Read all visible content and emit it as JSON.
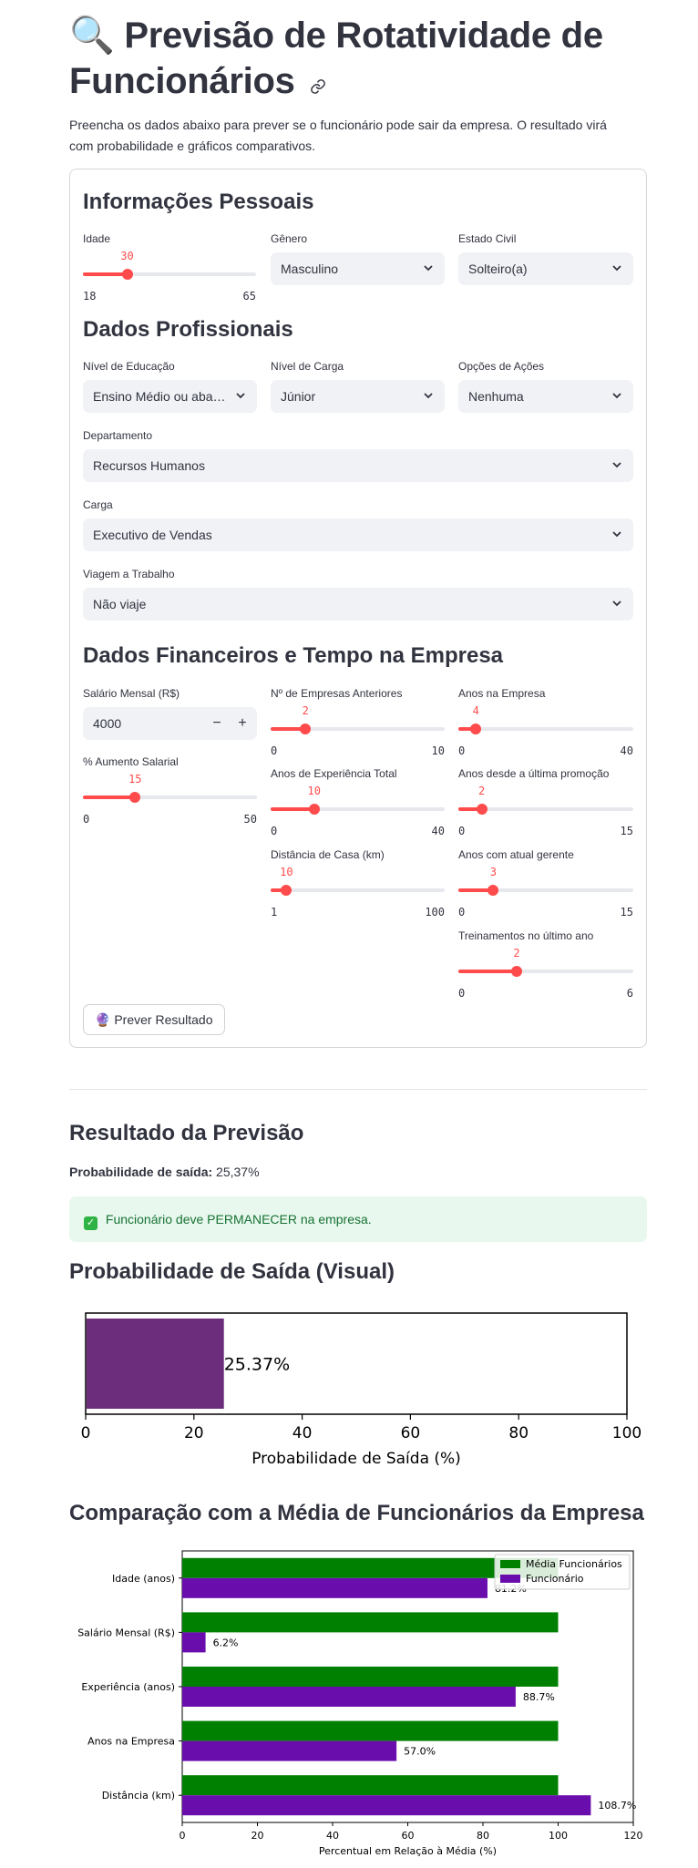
{
  "page": {
    "title_emoji": "🔍",
    "title": "Previsão de Rotatividade de Funcionários",
    "intro": "Preencha os dados abaixo para prever se o funcionário pode sair da empresa. O resultado virá com probabilidade e gráficos comparativos."
  },
  "personal": {
    "heading": "Informações Pessoais",
    "age": {
      "label": "Idade",
      "value": 30,
      "min": 18,
      "max": 65
    },
    "gender": {
      "label": "Gênero",
      "value": "Masculino"
    },
    "marital": {
      "label": "Estado Civil",
      "value": "Solteiro(a)"
    }
  },
  "professional": {
    "heading": "Dados Profissionais",
    "education": {
      "label": "Nível de Educação",
      "value": "Ensino Médio ou abaixo"
    },
    "job_level": {
      "label": "Nível de Carga",
      "value": "Júnior"
    },
    "stock": {
      "label": "Opções de Ações",
      "value": "Nenhuma"
    },
    "department": {
      "label": "Departamento",
      "value": "Recursos Humanos"
    },
    "role": {
      "label": "Carga",
      "value": "Executivo de Vendas"
    },
    "travel": {
      "label": "Viagem a Trabalho",
      "value": "Não viaje"
    }
  },
  "financial": {
    "heading": "Dados Financeiros e Tempo na Empresa",
    "salary": {
      "label": "Salário Mensal (R$)",
      "value": "4000",
      "minus": "−",
      "plus": "+"
    },
    "raise": {
      "label": "% Aumento Salarial",
      "value": 15,
      "min": 0,
      "max": 50
    },
    "prev_companies": {
      "label": "Nº de Empresas Anteriores",
      "value": 2,
      "min": 0,
      "max": 10
    },
    "total_exp": {
      "label": "Anos de Experiência Total",
      "value": 10,
      "min": 0,
      "max": 40
    },
    "distance": {
      "label": "Distância de Casa (km)",
      "value": 10,
      "min": 1,
      "max": 100
    },
    "years_company": {
      "label": "Anos na Empresa",
      "value": 4,
      "min": 0,
      "max": 40
    },
    "since_promo": {
      "label": "Anos desde a última promoção",
      "value": 2,
      "min": 0,
      "max": 15
    },
    "with_manager": {
      "label": "Anos com atual gerente",
      "value": 3,
      "min": 0,
      "max": 15
    },
    "trainings": {
      "label": "Treinamentos no último ano",
      "value": 2,
      "min": 0,
      "max": 6
    }
  },
  "predict_button": {
    "emoji": "🔮",
    "label": "Prever Resultado"
  },
  "result": {
    "heading": "Resultado da Previsão",
    "prob_label": "Probabilidade de saída:",
    "prob_value": "25,37%",
    "status_emoji": "✓",
    "status_text": "Funcionário deve PERMANECER na empresa.",
    "visual_heading": "Probabilidade de Saída (Visual)",
    "compare_heading": "Comparação com a Média de Funcionários da Empresa"
  },
  "colors": {
    "accent": "#ff4b4b",
    "purple_bar": "#6c2d7c",
    "green": "#008000",
    "violet": "#6a0dad",
    "success_bg": "#e8f8ee",
    "success_text": "#177233"
  },
  "chart_data": [
    {
      "type": "bar",
      "orientation": "horizontal",
      "values": [
        25.37
      ],
      "bar_label": "25.37%",
      "xlabel": "Probabilidade de Saída (%)",
      "xlim": [
        0,
        100
      ],
      "xticks": [
        "0",
        "20",
        "40",
        "60",
        "80",
        "100"
      ],
      "grid": false
    },
    {
      "type": "bar",
      "orientation": "horizontal",
      "categories": [
        "Idade (anos)",
        "Salário Mensal (R$)",
        "Experiência (anos)",
        "Anos na Empresa",
        "Distância (km)"
      ],
      "series": [
        {
          "name": "Média Funcionários",
          "values": [
            100,
            100,
            100,
            100,
            100
          ]
        },
        {
          "name": "Funcionário",
          "values": [
            81.2,
            6.2,
            88.7,
            57.0,
            108.7
          ]
        }
      ],
      "value_labels": [
        "81.2%",
        "6.2%",
        "88.7%",
        "57.0%",
        "108.7%"
      ],
      "xlabel": "Percentual em Relação à Média (%)",
      "xlim": [
        0,
        120
      ],
      "xticks": [
        "0",
        "20",
        "40",
        "60",
        "80",
        "100",
        "120"
      ],
      "legend": "top-right",
      "grid": false
    }
  ]
}
